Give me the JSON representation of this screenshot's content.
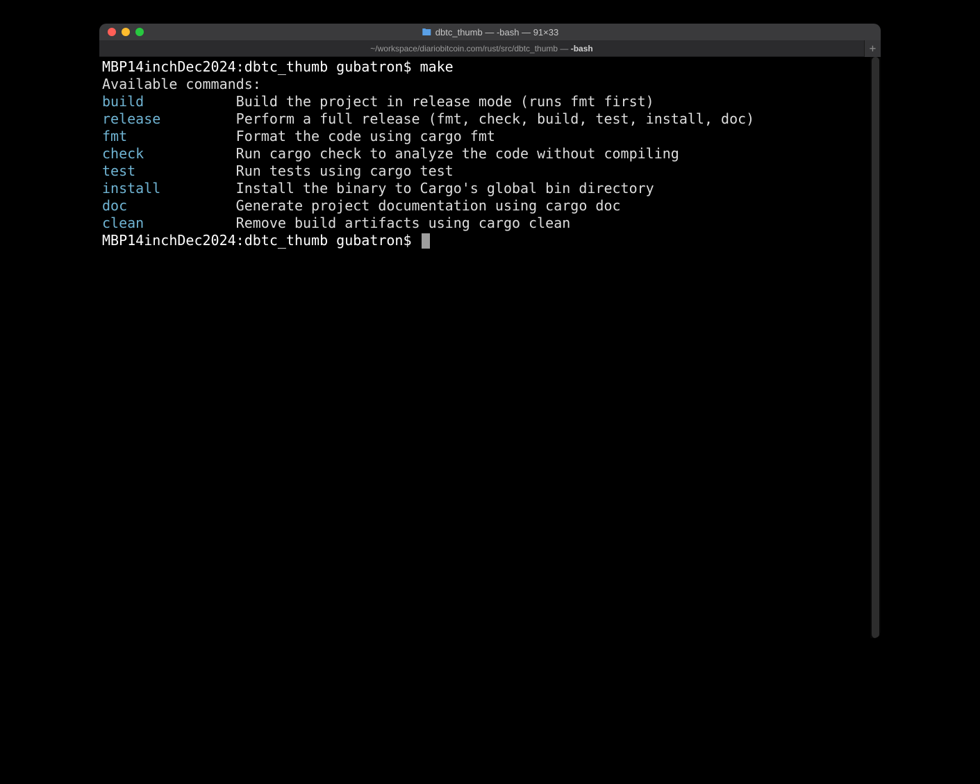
{
  "window": {
    "title": "dbtc_thumb — -bash — 91×33"
  },
  "tab": {
    "path": "~/workspace/diariobitcoin.com/rust/src/dbtc_thumb — ",
    "process": "-bash"
  },
  "terminal": {
    "prompt1": "MBP14inchDec2024:dbtc_thumb gubatron$ ",
    "typed_command": "make",
    "header": "Available commands:",
    "commands": [
      {
        "name": "build",
        "desc": "Build the project in release mode (runs fmt first)"
      },
      {
        "name": "release",
        "desc": "Perform a full release (fmt, check, build, test, install, doc)"
      },
      {
        "name": "fmt",
        "desc": "Format the code using cargo fmt"
      },
      {
        "name": "check",
        "desc": "Run cargo check to analyze the code without compiling"
      },
      {
        "name": "test",
        "desc": "Run tests using cargo test"
      },
      {
        "name": "install",
        "desc": "Install the binary to Cargo's global bin directory"
      },
      {
        "name": "doc",
        "desc": "Generate project documentation using cargo doc"
      },
      {
        "name": "clean",
        "desc": "Remove build artifacts using cargo clean"
      }
    ],
    "prompt2": "MBP14inchDec2024:dbtc_thumb gubatron$ "
  }
}
